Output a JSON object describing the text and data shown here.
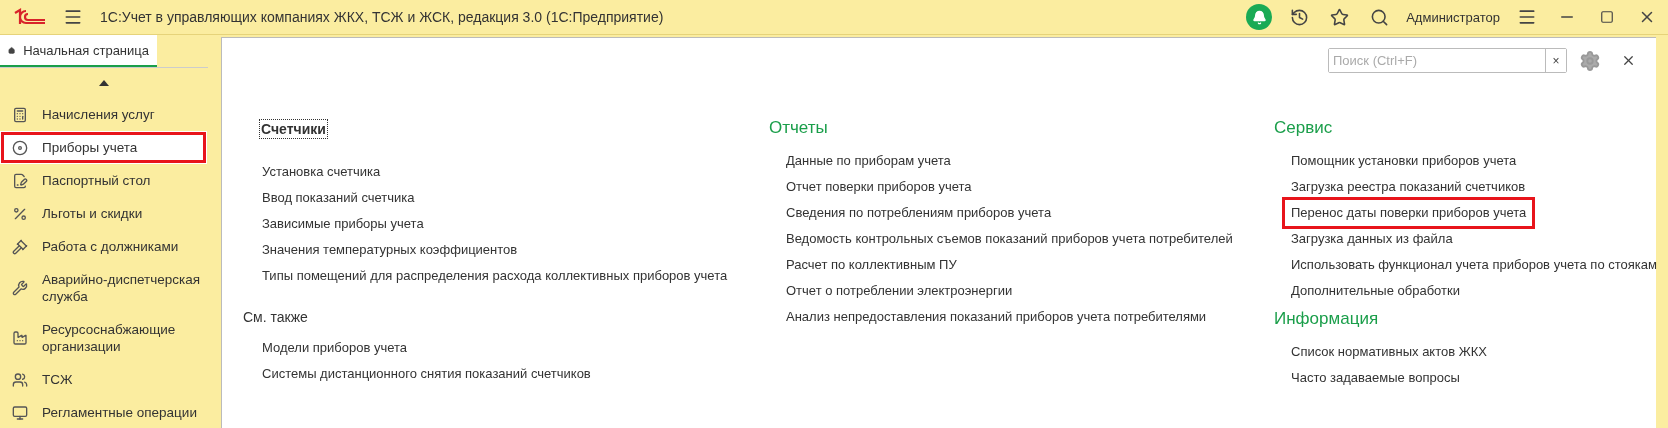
{
  "window": {
    "title": "1С:Учет в управляющих компаниях ЖКХ, ТСЖ и ЖСК, редакция 3.0  (1С:Предприятие)",
    "user": "Администратор"
  },
  "home_tab": {
    "label": "Начальная страница",
    "selected": true
  },
  "sidebar": {
    "items": [
      {
        "label": "Начисления услуг",
        "selected": false,
        "marked": false
      },
      {
        "label": "Приборы учета",
        "selected": true,
        "marked": true
      },
      {
        "label": "Паспортный стол",
        "selected": false,
        "marked": false
      },
      {
        "label": "Льготы и скидки",
        "selected": false,
        "marked": false
      },
      {
        "label": "Работа с должниками",
        "selected": false,
        "marked": false
      },
      {
        "label": "Аварийно-диспетчерская служба",
        "selected": false,
        "marked": false
      },
      {
        "label": "Ресурсоснабжающие организации",
        "selected": false,
        "marked": false
      },
      {
        "label": "ТСЖ",
        "selected": false,
        "marked": false
      },
      {
        "label": "Регламентные операции",
        "selected": false,
        "marked": false
      }
    ]
  },
  "search": {
    "placeholder": "Поиск (Ctrl+F)",
    "clear": "×"
  },
  "columns": [
    {
      "groups": [
        {
          "kind": "subsystem",
          "title": "Счетчики",
          "focused": true,
          "items": [
            {
              "label": "Установка счетчика",
              "marked": false
            },
            {
              "label": "Ввод показаний счетчика",
              "marked": false
            },
            {
              "label": "Зависимые приборы учета",
              "marked": false
            },
            {
              "label": "Значения температурных коэффициентов",
              "marked": false
            },
            {
              "label": "Типы помещений для распределения расхода коллективных приборов учета",
              "marked": false
            }
          ]
        },
        {
          "kind": "see-also",
          "title": "См. также",
          "focused": false,
          "items": [
            {
              "label": "Модели приборов учета",
              "marked": false
            },
            {
              "label": "Системы дистанционного снятия показаний счетчиков",
              "marked": false
            }
          ]
        }
      ]
    },
    {
      "groups": [
        {
          "kind": "section",
          "title": "Отчеты",
          "focused": false,
          "items": [
            {
              "label": "Данные по приборам учета",
              "marked": false
            },
            {
              "label": "Отчет поверки приборов учета",
              "marked": false
            },
            {
              "label": "Сведения по потреблениям приборов учета",
              "marked": false
            },
            {
              "label": "Ведомость контрольных съемов показаний приборов учета потребителей",
              "marked": false
            },
            {
              "label": "Расчет по коллективным ПУ",
              "marked": false
            },
            {
              "label": "Отчет о потреблении электроэнергии",
              "marked": false
            },
            {
              "label": "Анализ непредоставления показаний приборов учета потребителями",
              "marked": false
            }
          ]
        }
      ]
    },
    {
      "groups": [
        {
          "kind": "section",
          "title": "Сервис",
          "focused": false,
          "items": [
            {
              "label": "Помощник установки приборов учета",
              "marked": false
            },
            {
              "label": "Загрузка реестра показаний счетчиков",
              "marked": false
            },
            {
              "label": "Перенос даты поверки приборов учета",
              "marked": true
            },
            {
              "label": "Загрузка данных из файла",
              "marked": false
            },
            {
              "label": "Использовать функционал учета приборов учета по стоякам",
              "marked": false
            },
            {
              "label": "Дополнительные обработки",
              "marked": false
            }
          ]
        },
        {
          "kind": "section",
          "title": "Информация",
          "focused": false,
          "items": [
            {
              "label": "Список нормативных актов ЖКХ",
              "marked": false
            },
            {
              "label": "Часто задаваемые вопросы",
              "marked": false
            }
          ]
        }
      ]
    }
  ]
}
